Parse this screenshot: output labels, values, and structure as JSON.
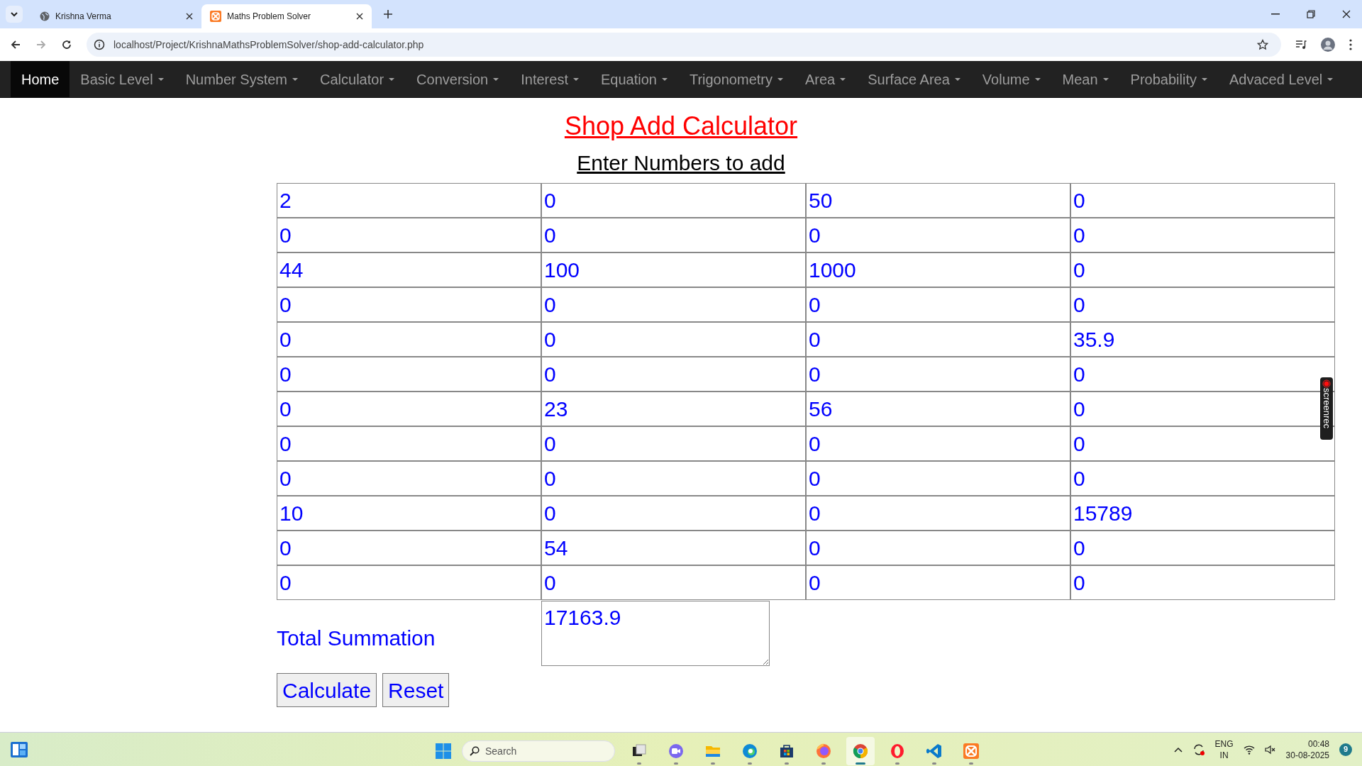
{
  "browser": {
    "tabs": [
      {
        "title": "Krishna Verma",
        "selected": false,
        "kind": "globe"
      },
      {
        "title": "Maths Problem Solver",
        "selected": true,
        "kind": "app"
      }
    ],
    "address": "localhost/Project/KrishnaMathsProblemSolver/shop-add-calculator.php"
  },
  "nav": [
    {
      "label": "Home",
      "selected": true,
      "dropdown": false
    },
    {
      "label": "Basic Level",
      "selected": false,
      "dropdown": true
    },
    {
      "label": "Number System",
      "selected": false,
      "dropdown": true
    },
    {
      "label": "Calculator",
      "selected": false,
      "dropdown": true
    },
    {
      "label": "Conversion",
      "selected": false,
      "dropdown": true
    },
    {
      "label": "Interest",
      "selected": false,
      "dropdown": true
    },
    {
      "label": "Equation",
      "selected": false,
      "dropdown": true
    },
    {
      "label": "Trigonometry",
      "selected": false,
      "dropdown": true
    },
    {
      "label": "Area",
      "selected": false,
      "dropdown": true
    },
    {
      "label": "Surface Area",
      "selected": false,
      "dropdown": true
    },
    {
      "label": "Volume",
      "selected": false,
      "dropdown": true
    },
    {
      "label": "Mean",
      "selected": false,
      "dropdown": true
    },
    {
      "label": "Probability",
      "selected": false,
      "dropdown": true
    },
    {
      "label": "Advaced Level",
      "selected": false,
      "dropdown": true
    }
  ],
  "title": "Shop Add Calculator",
  "subtitle": "Enter Numbers to add",
  "grid": [
    [
      "2",
      "0",
      "50",
      "0"
    ],
    [
      "0",
      "0",
      "0",
      "0"
    ],
    [
      "44",
      "100",
      "1000",
      "0"
    ],
    [
      "0",
      "0",
      "0",
      "0"
    ],
    [
      "0",
      "0",
      "0",
      "35.9"
    ],
    [
      "0",
      "0",
      "0",
      "0"
    ],
    [
      "0",
      "23",
      "56",
      "0"
    ],
    [
      "0",
      "0",
      "0",
      "0"
    ],
    [
      "0",
      "0",
      "0",
      "0"
    ],
    [
      "10",
      "0",
      "0",
      "15789"
    ],
    [
      "0",
      "54",
      "0",
      "0"
    ],
    [
      "0",
      "0",
      "0",
      "0"
    ]
  ],
  "total": {
    "label": "Total Summation",
    "value": "17163.9"
  },
  "buttons": [
    "Calculate",
    "Reset"
  ],
  "screenrec": "screenrec",
  "taskbar": {
    "search_placeholder": "Search",
    "apps": [
      {
        "kind": "taskview",
        "active": false
      },
      {
        "kind": "chat",
        "active": false
      },
      {
        "kind": "files",
        "active": false
      },
      {
        "kind": "edge",
        "active": false
      },
      {
        "kind": "store",
        "active": false
      },
      {
        "kind": "firefox",
        "active": false
      },
      {
        "kind": "chrome",
        "active": true
      },
      {
        "kind": "opera",
        "active": false
      },
      {
        "kind": "vscode",
        "active": false
      },
      {
        "kind": "xampp",
        "active": false
      }
    ],
    "language": "ENG",
    "region": "IN",
    "time": "00:48",
    "date": "30-08-2025",
    "badge": "9"
  }
}
